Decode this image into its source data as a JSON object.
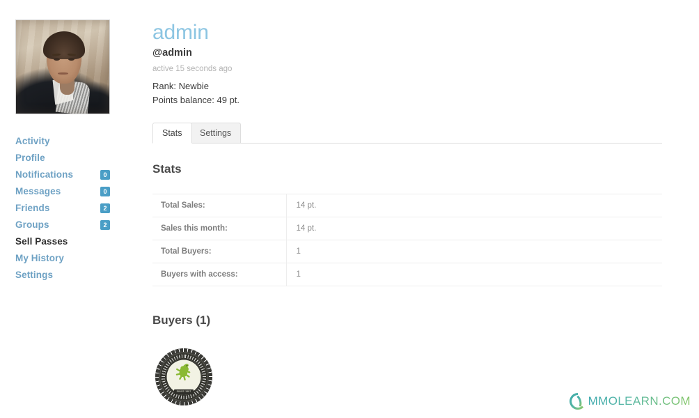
{
  "profile": {
    "display_name": "admin",
    "handle": "@admin",
    "activity": "active 15 seconds ago",
    "rank": "Rank: Newbie",
    "points_balance": "Points balance: 49 pt.",
    "avatar_icon": "user-photo-avatar",
    "name_color": "#8cc5e2"
  },
  "sidebar": {
    "items": [
      {
        "label": "Activity",
        "badge": null,
        "active": false
      },
      {
        "label": "Profile",
        "badge": null,
        "active": false
      },
      {
        "label": "Notifications",
        "badge": "0",
        "active": false
      },
      {
        "label": "Messages",
        "badge": "0",
        "active": false
      },
      {
        "label": "Friends",
        "badge": "2",
        "active": false
      },
      {
        "label": "Groups",
        "badge": "2",
        "active": false
      },
      {
        "label": "Sell Passes",
        "badge": null,
        "active": true
      },
      {
        "label": "My History",
        "badge": null,
        "active": false
      },
      {
        "label": "Settings",
        "badge": null,
        "active": false
      }
    ],
    "link_color": "#6fa2c4",
    "badge_color": "#4a9ec6"
  },
  "tabs": [
    {
      "label": "Stats",
      "active": true
    },
    {
      "label": "Settings",
      "active": false
    }
  ],
  "stats": {
    "heading": "Stats",
    "rows": [
      {
        "key": "Total Sales:",
        "value": "14 pt."
      },
      {
        "key": "Sales this month:",
        "value": "14 pt."
      },
      {
        "key": "Total Buyers:",
        "value": "1"
      },
      {
        "key": "Buyers with access:",
        "value": "1"
      }
    ]
  },
  "buyers": {
    "heading": "Buyers (1)",
    "items": [
      {
        "avatar_icon": "bottle-cap-lion-crest-avatar",
        "banner_text": "SINCE 1887"
      }
    ]
  },
  "watermark": {
    "text": "MMOLEARN.COM",
    "icon": "mmolearn-swoosh-logo"
  }
}
